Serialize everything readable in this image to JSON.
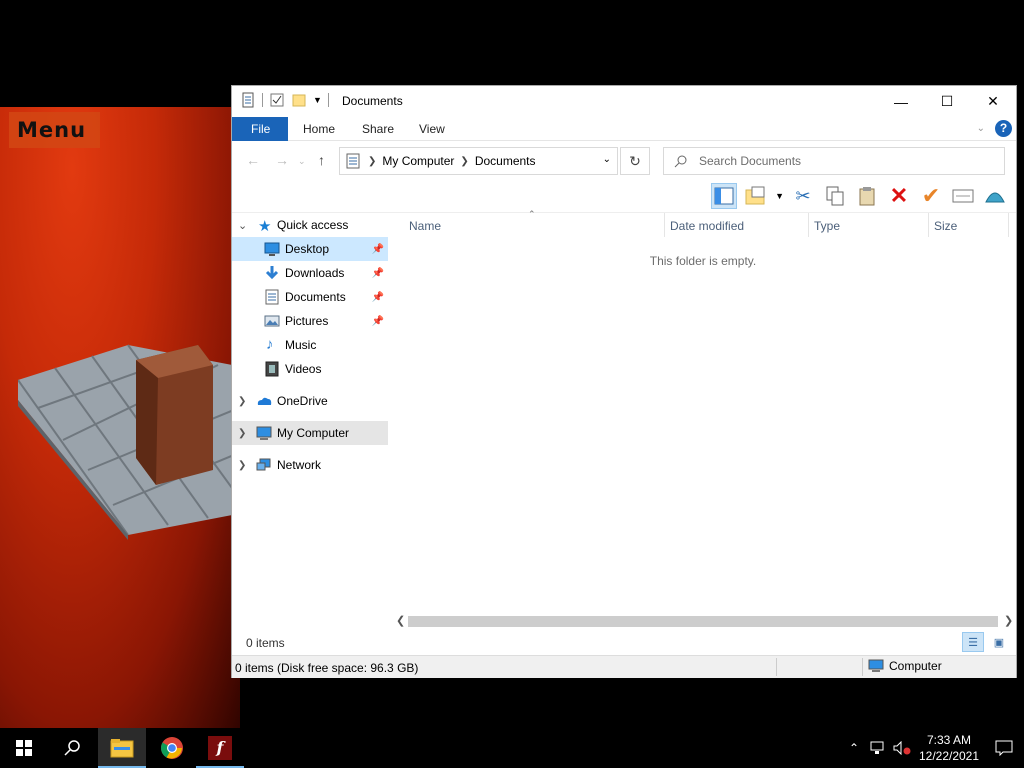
{
  "desktop": {
    "game_menu_label": "Menu"
  },
  "window": {
    "title": "Documents",
    "controls": {
      "minimize": "—",
      "maximize": "☐",
      "close": "✕"
    }
  },
  "ribbon": {
    "tabs": [
      {
        "label": "File"
      },
      {
        "label": "Home"
      },
      {
        "label": "Share"
      },
      {
        "label": "View"
      }
    ]
  },
  "address": {
    "crumbs": [
      "My Computer",
      "Documents"
    ],
    "search_placeholder": "Search Documents"
  },
  "navpane": {
    "quick_access": "Quick access",
    "pinned": [
      {
        "label": "Desktop",
        "icon": "desktop-icon"
      },
      {
        "label": "Downloads",
        "icon": "downloads-icon"
      },
      {
        "label": "Documents",
        "icon": "documents-icon"
      },
      {
        "label": "Pictures",
        "icon": "pictures-icon"
      },
      {
        "label": "Music",
        "icon": "music-icon"
      },
      {
        "label": "Videos",
        "icon": "videos-icon"
      }
    ],
    "roots": [
      {
        "label": "OneDrive",
        "icon": "onedrive-icon"
      },
      {
        "label": "My Computer",
        "icon": "computer-icon"
      },
      {
        "label": "Network",
        "icon": "network-icon"
      }
    ]
  },
  "content": {
    "columns": [
      "Name",
      "Date modified",
      "Type",
      "Size"
    ],
    "empty_message": "This folder is empty."
  },
  "status": {
    "item_count": "0 items",
    "detail": "0 items (Disk free space: 96.3 GB)",
    "zone": "Computer"
  },
  "taskbar": {
    "time": "7:33 AM",
    "date": "12/22/2021"
  },
  "colors": {
    "accent": "#1a64b8",
    "selection": "#cce8ff"
  }
}
